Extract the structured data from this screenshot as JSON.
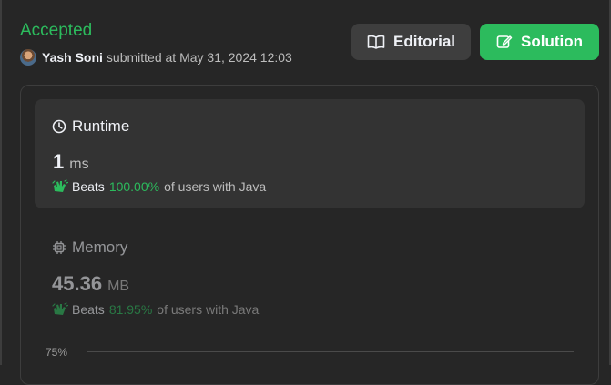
{
  "header": {
    "status": "Accepted",
    "user_name": "Yash Soni",
    "submitted_text": "submitted at May 31, 2024 12:03"
  },
  "buttons": {
    "editorial_label": "Editorial",
    "solution_label": "Solution"
  },
  "runtime": {
    "title": "Runtime",
    "value": "1",
    "unit": "ms",
    "beats_label": "Beats",
    "percent": "100.00%",
    "suffix": "of users with Java"
  },
  "memory": {
    "title": "Memory",
    "value": "45.36",
    "unit": "MB",
    "beats_label": "Beats",
    "percent": "81.95%",
    "suffix": "of users with Java"
  },
  "chart": {
    "y_tick": "75%"
  },
  "colors": {
    "accent_green": "#2cbb5d",
    "background": "#262626",
    "card": "#333333"
  }
}
